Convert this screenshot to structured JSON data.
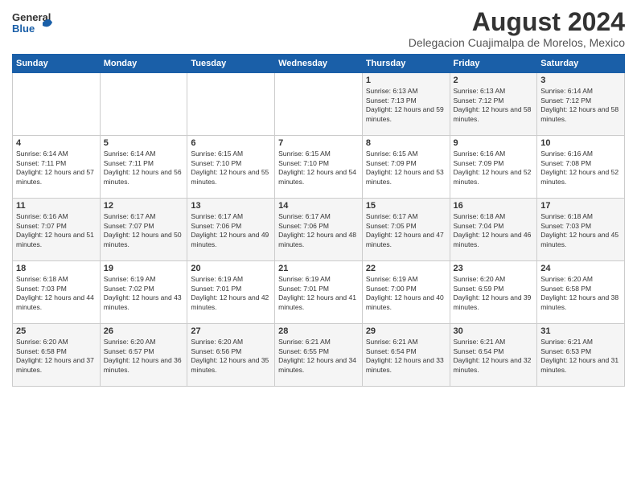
{
  "header": {
    "logo_general": "General",
    "logo_blue": "Blue",
    "month_year": "August 2024",
    "location": "Delegacion Cuajimalpa de Morelos, Mexico"
  },
  "weekdays": [
    "Sunday",
    "Monday",
    "Tuesday",
    "Wednesday",
    "Thursday",
    "Friday",
    "Saturday"
  ],
  "weeks": [
    [
      {
        "day": "",
        "sunrise": "",
        "sunset": "",
        "daylight": ""
      },
      {
        "day": "",
        "sunrise": "",
        "sunset": "",
        "daylight": ""
      },
      {
        "day": "",
        "sunrise": "",
        "sunset": "",
        "daylight": ""
      },
      {
        "day": "",
        "sunrise": "",
        "sunset": "",
        "daylight": ""
      },
      {
        "day": "1",
        "sunrise": "Sunrise: 6:13 AM",
        "sunset": "Sunset: 7:13 PM",
        "daylight": "Daylight: 12 hours and 59 minutes."
      },
      {
        "day": "2",
        "sunrise": "Sunrise: 6:13 AM",
        "sunset": "Sunset: 7:12 PM",
        "daylight": "Daylight: 12 hours and 58 minutes."
      },
      {
        "day": "3",
        "sunrise": "Sunrise: 6:14 AM",
        "sunset": "Sunset: 7:12 PM",
        "daylight": "Daylight: 12 hours and 58 minutes."
      }
    ],
    [
      {
        "day": "4",
        "sunrise": "Sunrise: 6:14 AM",
        "sunset": "Sunset: 7:11 PM",
        "daylight": "Daylight: 12 hours and 57 minutes."
      },
      {
        "day": "5",
        "sunrise": "Sunrise: 6:14 AM",
        "sunset": "Sunset: 7:11 PM",
        "daylight": "Daylight: 12 hours and 56 minutes."
      },
      {
        "day": "6",
        "sunrise": "Sunrise: 6:15 AM",
        "sunset": "Sunset: 7:10 PM",
        "daylight": "Daylight: 12 hours and 55 minutes."
      },
      {
        "day": "7",
        "sunrise": "Sunrise: 6:15 AM",
        "sunset": "Sunset: 7:10 PM",
        "daylight": "Daylight: 12 hours and 54 minutes."
      },
      {
        "day": "8",
        "sunrise": "Sunrise: 6:15 AM",
        "sunset": "Sunset: 7:09 PM",
        "daylight": "Daylight: 12 hours and 53 minutes."
      },
      {
        "day": "9",
        "sunrise": "Sunrise: 6:16 AM",
        "sunset": "Sunset: 7:09 PM",
        "daylight": "Daylight: 12 hours and 52 minutes."
      },
      {
        "day": "10",
        "sunrise": "Sunrise: 6:16 AM",
        "sunset": "Sunset: 7:08 PM",
        "daylight": "Daylight: 12 hours and 52 minutes."
      }
    ],
    [
      {
        "day": "11",
        "sunrise": "Sunrise: 6:16 AM",
        "sunset": "Sunset: 7:07 PM",
        "daylight": "Daylight: 12 hours and 51 minutes."
      },
      {
        "day": "12",
        "sunrise": "Sunrise: 6:17 AM",
        "sunset": "Sunset: 7:07 PM",
        "daylight": "Daylight: 12 hours and 50 minutes."
      },
      {
        "day": "13",
        "sunrise": "Sunrise: 6:17 AM",
        "sunset": "Sunset: 7:06 PM",
        "daylight": "Daylight: 12 hours and 49 minutes."
      },
      {
        "day": "14",
        "sunrise": "Sunrise: 6:17 AM",
        "sunset": "Sunset: 7:06 PM",
        "daylight": "Daylight: 12 hours and 48 minutes."
      },
      {
        "day": "15",
        "sunrise": "Sunrise: 6:17 AM",
        "sunset": "Sunset: 7:05 PM",
        "daylight": "Daylight: 12 hours and 47 minutes."
      },
      {
        "day": "16",
        "sunrise": "Sunrise: 6:18 AM",
        "sunset": "Sunset: 7:04 PM",
        "daylight": "Daylight: 12 hours and 46 minutes."
      },
      {
        "day": "17",
        "sunrise": "Sunrise: 6:18 AM",
        "sunset": "Sunset: 7:03 PM",
        "daylight": "Daylight: 12 hours and 45 minutes."
      }
    ],
    [
      {
        "day": "18",
        "sunrise": "Sunrise: 6:18 AM",
        "sunset": "Sunset: 7:03 PM",
        "daylight": "Daylight: 12 hours and 44 minutes."
      },
      {
        "day": "19",
        "sunrise": "Sunrise: 6:19 AM",
        "sunset": "Sunset: 7:02 PM",
        "daylight": "Daylight: 12 hours and 43 minutes."
      },
      {
        "day": "20",
        "sunrise": "Sunrise: 6:19 AM",
        "sunset": "Sunset: 7:01 PM",
        "daylight": "Daylight: 12 hours and 42 minutes."
      },
      {
        "day": "21",
        "sunrise": "Sunrise: 6:19 AM",
        "sunset": "Sunset: 7:01 PM",
        "daylight": "Daylight: 12 hours and 41 minutes."
      },
      {
        "day": "22",
        "sunrise": "Sunrise: 6:19 AM",
        "sunset": "Sunset: 7:00 PM",
        "daylight": "Daylight: 12 hours and 40 minutes."
      },
      {
        "day": "23",
        "sunrise": "Sunrise: 6:20 AM",
        "sunset": "Sunset: 6:59 PM",
        "daylight": "Daylight: 12 hours and 39 minutes."
      },
      {
        "day": "24",
        "sunrise": "Sunrise: 6:20 AM",
        "sunset": "Sunset: 6:58 PM",
        "daylight": "Daylight: 12 hours and 38 minutes."
      }
    ],
    [
      {
        "day": "25",
        "sunrise": "Sunrise: 6:20 AM",
        "sunset": "Sunset: 6:58 PM",
        "daylight": "Daylight: 12 hours and 37 minutes."
      },
      {
        "day": "26",
        "sunrise": "Sunrise: 6:20 AM",
        "sunset": "Sunset: 6:57 PM",
        "daylight": "Daylight: 12 hours and 36 minutes."
      },
      {
        "day": "27",
        "sunrise": "Sunrise: 6:20 AM",
        "sunset": "Sunset: 6:56 PM",
        "daylight": "Daylight: 12 hours and 35 minutes."
      },
      {
        "day": "28",
        "sunrise": "Sunrise: 6:21 AM",
        "sunset": "Sunset: 6:55 PM",
        "daylight": "Daylight: 12 hours and 34 minutes."
      },
      {
        "day": "29",
        "sunrise": "Sunrise: 6:21 AM",
        "sunset": "Sunset: 6:54 PM",
        "daylight": "Daylight: 12 hours and 33 minutes."
      },
      {
        "day": "30",
        "sunrise": "Sunrise: 6:21 AM",
        "sunset": "Sunset: 6:54 PM",
        "daylight": "Daylight: 12 hours and 32 minutes."
      },
      {
        "day": "31",
        "sunrise": "Sunrise: 6:21 AM",
        "sunset": "Sunset: 6:53 PM",
        "daylight": "Daylight: 12 hours and 31 minutes."
      }
    ]
  ]
}
